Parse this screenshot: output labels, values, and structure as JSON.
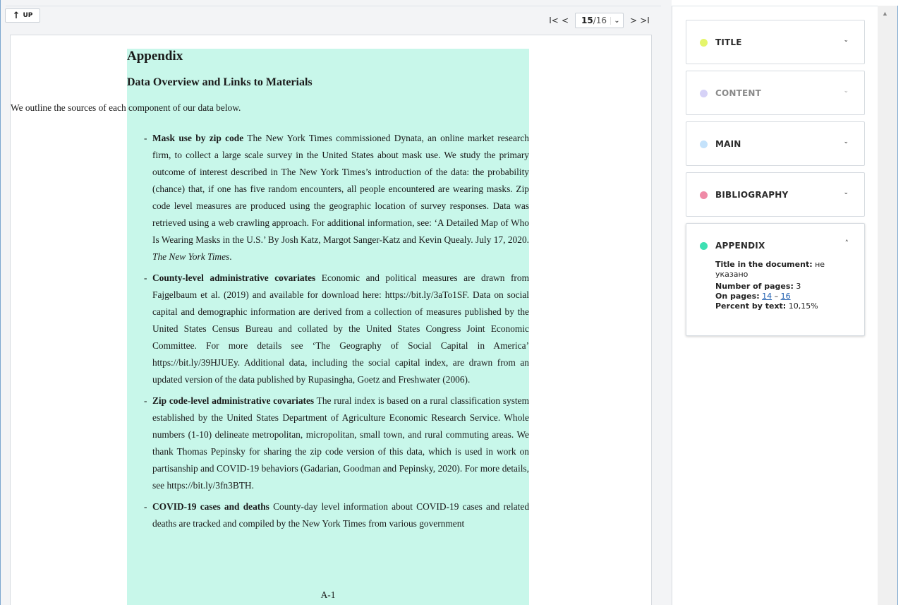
{
  "toolbar": {
    "up_label": "UP",
    "up_icon": "arrow-up-icon",
    "first_icon": "first-page-icon",
    "prev_icon": "prev-page-icon",
    "next_icon": "next-page-icon",
    "last_icon": "last-page-icon",
    "current_page": "15",
    "total_pages": "/16"
  },
  "document": {
    "heading": "Appendix",
    "subheading": "Data Overview and Links to Materials",
    "intro": "We outline the sources of each component of our data below.",
    "items": [
      {
        "title": "Mask use by zip code",
        "text": " The New York Times commissioned Dynata, an online market research firm, to collect a large scale survey in the United States about mask use. We study the primary outcome of interest described in The New York Times’s introduction of the data: the probability (chance) that, if one has five random encounters, all people encountered are wearing masks.  Zip code level measures are produced using the geographic location of survey responses.  Data was retrieved using a web crawling approach.  For additional information, see: ‘A Detailed Map of Who Is Wearing Masks in the U.S.’ By Josh Katz, Margot Sanger-Katz and Kevin Quealy. July 17, 2020. ",
        "italic": "The New York Times",
        "end": "."
      },
      {
        "title": "County-level administrative covariates",
        "text": " Economic and political measures are drawn from Fajgelbaum et al. (2019) and available for download here: https://bit.ly/3aTo1SF. Data on social capital and demographic information are derived from a collection of measures published by the United States Census Bureau and collated by the United States Congress Joint Economic Committee.  For more details see ‘The Geography of Social Capital in America’ https://bit.ly/39HJUEy.  Additional data, including the social capital index, are drawn from an updated version of the data published by Rupasingha, Goetz and Freshwater (2006).",
        "italic": "",
        "end": ""
      },
      {
        "title": "Zip code-level administrative covariates",
        "text": " The rural index is based on a rural classification system established by the United States Department of Agriculture Economic Research Service. Whole numbers (1-10) delineate metropolitan, micropolitan, small town, and rural commuting areas. We thank Thomas Pepinsky for sharing the zip code version of this data, which is used in work on partisanship and COVID-19 behaviors (Gadarian, Goodman and Pepinsky, 2020). For more details, see https://bit.ly/3fn3BTH.",
        "italic": "",
        "end": ""
      },
      {
        "title": "COVID-19 cases and deaths",
        "text": " County-day level information about COVID-19 cases and related deaths are tracked and compiled by the New York Times from various government",
        "italic": "",
        "end": ""
      }
    ],
    "page_footer": "A-1",
    "item_dash": "-"
  },
  "sections": [
    {
      "label": "TITLE",
      "color": "#e5f56b",
      "chevron": "⌄",
      "expanded": false,
      "dim": false
    },
    {
      "label": "CONTENT",
      "color": "#d6d2f7",
      "chevron": "⌄",
      "expanded": false,
      "dim": true
    },
    {
      "label": "MAIN",
      "color": "#c4e2fb",
      "chevron": "⌄",
      "expanded": false,
      "dim": false
    },
    {
      "label": "BIBLIOGRAPHY",
      "color": "#ef8aa7",
      "chevron": "⌄",
      "expanded": false,
      "dim": false
    },
    {
      "label": "APPENDIX",
      "color": "#3ee0b3",
      "chevron": "˄",
      "expanded": true,
      "dim": false
    }
  ],
  "appendix_details": {
    "title_label": "Title in the document:",
    "title_value": " не указано",
    "pages_label": "Number of pages:",
    "pages_value": " 3",
    "on_pages_label": "On pages:",
    "on_pages_from": "14",
    "on_pages_sep": " – ",
    "on_pages_to": "16",
    "percent_label": "Percent by text:",
    "percent_value": " 10,15%"
  },
  "colors": {
    "page_highlight": "#c8f7ea",
    "frame_border": "#7aa6cf",
    "link": "#1f5fb0"
  },
  "scrollbar": {
    "up_icon": "scroll-up-arrow-icon"
  }
}
